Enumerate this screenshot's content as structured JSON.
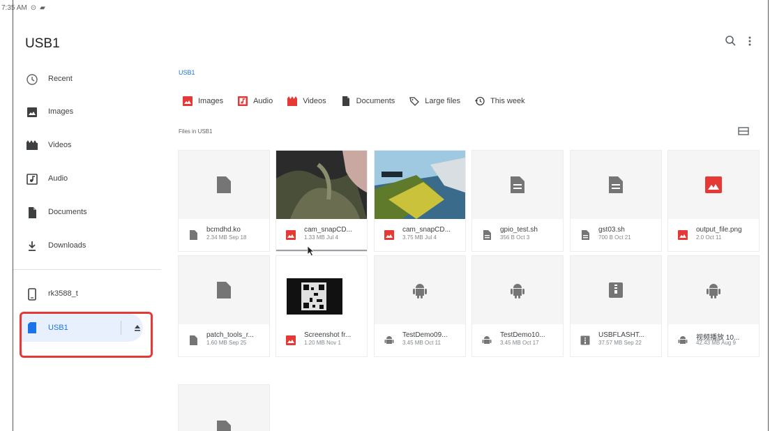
{
  "status_bar": {
    "time": "7:35 AM"
  },
  "app_bar": {
    "title": "USB1"
  },
  "sidebar": {
    "items": [
      {
        "label": "Recent",
        "icon": "clock-icon"
      },
      {
        "label": "Images",
        "icon": "image-icon"
      },
      {
        "label": "Videos",
        "icon": "videos-icon"
      },
      {
        "label": "Audio",
        "icon": "audio-icon"
      },
      {
        "label": "Documents",
        "icon": "document-icon"
      },
      {
        "label": "Downloads",
        "icon": "download-icon"
      }
    ],
    "devices": [
      {
        "label": "rk3588_t",
        "icon": "phone-icon"
      },
      {
        "label": "USB1",
        "icon": "sd-card-icon",
        "selected": true
      }
    ]
  },
  "main": {
    "breadcrumb": "USB1",
    "chips": [
      {
        "label": "Images",
        "icon": "image-icon"
      },
      {
        "label": "Audio",
        "icon": "audio-icon"
      },
      {
        "label": "Videos",
        "icon": "videos-icon"
      },
      {
        "label": "Documents",
        "icon": "document-icon"
      },
      {
        "label": "Large files",
        "icon": "tag-icon"
      },
      {
        "label": "This week",
        "icon": "history-icon"
      }
    ],
    "section_label": "Files in USB1",
    "files": [
      {
        "name": "bcmdhd.ko",
        "info": "2.34 MB Sep 18",
        "type": "file"
      },
      {
        "name": "cam_snapCD...",
        "info": "1.33 MB Jul 4",
        "type": "image-dark"
      },
      {
        "name": "cam_snapCD...",
        "info": "3.75 MB Jul 4",
        "type": "image-color"
      },
      {
        "name": "gpio_test.sh",
        "info": "356 B Oct 3",
        "type": "doc"
      },
      {
        "name": "gst03.sh",
        "info": "700 B Oct 21",
        "type": "doc"
      },
      {
        "name": "output_file.png",
        "info": "2.0 Oct 11",
        "type": "image-icon"
      },
      {
        "name": "patch_tools_r...",
        "info": "1.60 MB Sep 25",
        "type": "file"
      },
      {
        "name": "Screenshot fr...",
        "info": "1.20 MB Nov 1",
        "type": "image-qr"
      },
      {
        "name": "TestDemo09...",
        "info": "3.45 MB Oct 11",
        "type": "apk"
      },
      {
        "name": "TestDemo10...",
        "info": "3.45 MB Oct 17",
        "type": "apk"
      },
      {
        "name": "USBFLASHT...",
        "info": "37.57 MB Sep 22",
        "type": "archive"
      },
      {
        "name": "视频播放 10...",
        "info": "42.43 MB Aug 9",
        "type": "apk"
      }
    ]
  },
  "colors": {
    "accent": "#1a73e8",
    "selected_bg": "#e8f0fe",
    "media_red": "#e53935",
    "highlight_box": "#e53935",
    "icon_gray": "#757575"
  }
}
